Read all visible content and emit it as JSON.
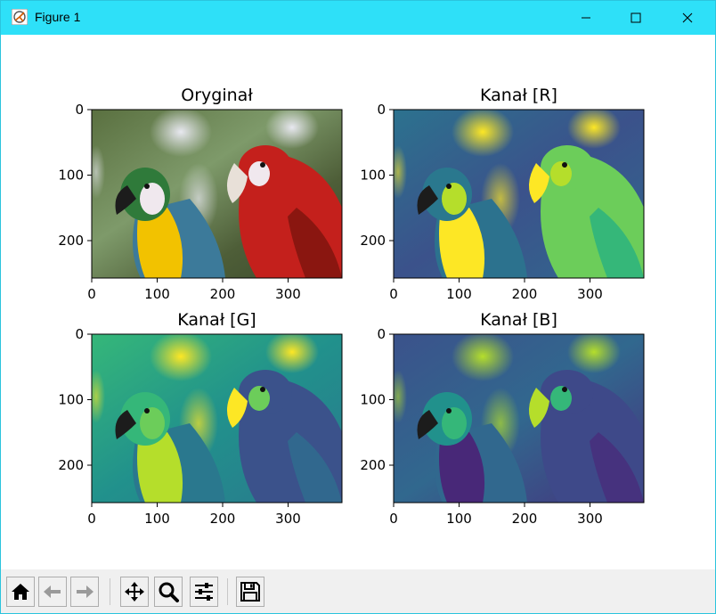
{
  "window": {
    "title": "Figure 1",
    "controls": [
      "minimize",
      "maximize",
      "close"
    ]
  },
  "subplots": [
    {
      "title": "Oryginał",
      "kind": "rgb",
      "x_ticks": [
        "0",
        "100",
        "200",
        "300"
      ],
      "y_ticks": [
        "0",
        "100",
        "200"
      ]
    },
    {
      "title": "Kanał [R]",
      "kind": "channel-r",
      "x_ticks": [
        "0",
        "100",
        "200",
        "300"
      ],
      "y_ticks": [
        "0",
        "100",
        "200"
      ]
    },
    {
      "title": "Kanał [G]",
      "kind": "channel-g",
      "x_ticks": [
        "0",
        "100",
        "200",
        "300"
      ],
      "y_ticks": [
        "0",
        "100",
        "200"
      ]
    },
    {
      "title": "Kanał [B]",
      "kind": "channel-b",
      "x_ticks": [
        "0",
        "100",
        "200",
        "300"
      ],
      "y_ticks": [
        "0",
        "100",
        "200"
      ]
    }
  ],
  "toolbar": {
    "buttons": [
      "home-icon",
      "back-icon",
      "forward-icon",
      "pan-icon",
      "zoom-icon",
      "configure-subplots-icon",
      "save-icon"
    ]
  },
  "colors": {
    "titlebar": "#2ee0f8",
    "viridis_dark": "#440154",
    "viridis_mid": "#21918c",
    "viridis_light": "#fde725"
  }
}
